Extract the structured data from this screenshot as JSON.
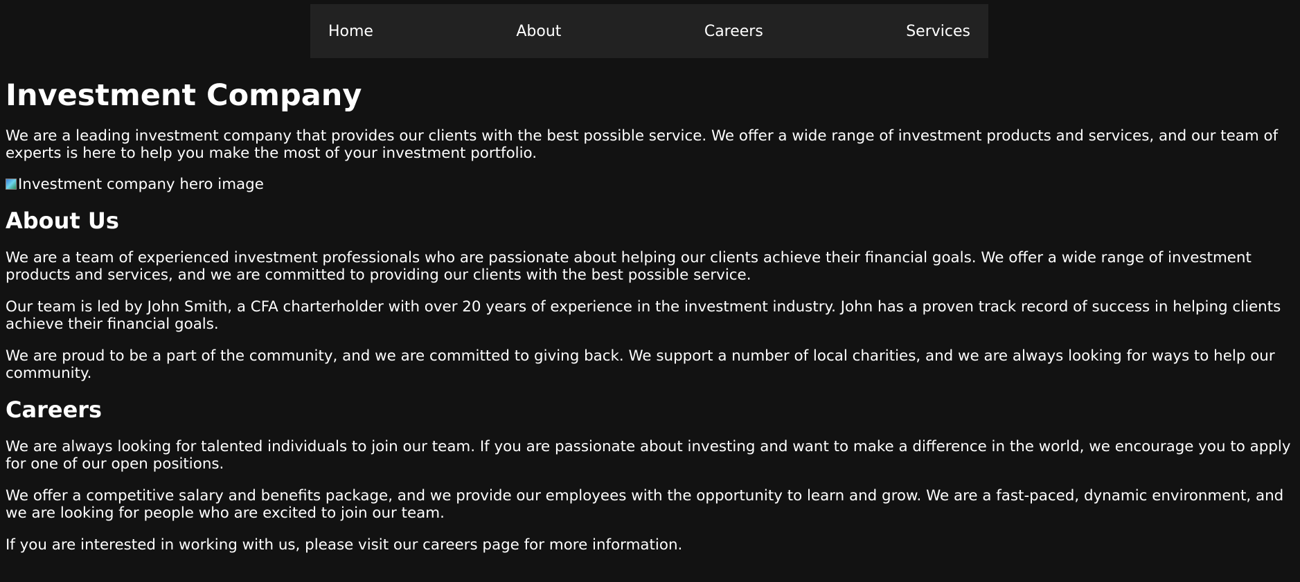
{
  "nav": {
    "items": [
      {
        "label": "Home"
      },
      {
        "label": "About"
      },
      {
        "label": "Careers"
      },
      {
        "label": "Services"
      }
    ]
  },
  "hero": {
    "title": "Investment Company",
    "intro": "We are a leading investment company that provides our clients with the best possible service. We offer a wide range of investment products and services, and our team of experts is here to help you make the most of your investment portfolio.",
    "image_alt": "Investment company hero image"
  },
  "about": {
    "heading": "About Us",
    "paragraphs": [
      "We are a team of experienced investment professionals who are passionate about helping our clients achieve their financial goals. We offer a wide range of investment products and services, and we are committed to providing our clients with the best possible service.",
      "Our team is led by John Smith, a CFA charterholder with over 20 years of experience in the investment industry. John has a proven track record of success in helping clients achieve their financial goals.",
      "We are proud to be a part of the community, and we are committed to giving back. We support a number of local charities, and we are always looking for ways to help our community."
    ]
  },
  "careers": {
    "heading": "Careers",
    "paragraphs": [
      "We are always looking for talented individuals to join our team. If you are passionate about investing and want to make a difference in the world, we encourage you to apply for one of our open positions.",
      "We offer a competitive salary and benefits package, and we provide our employees with the opportunity to learn and grow. We are a fast-paced, dynamic environment, and we are looking for people who are excited to join our team.",
      "If you are interested in working with us, please visit our careers page for more information."
    ]
  }
}
